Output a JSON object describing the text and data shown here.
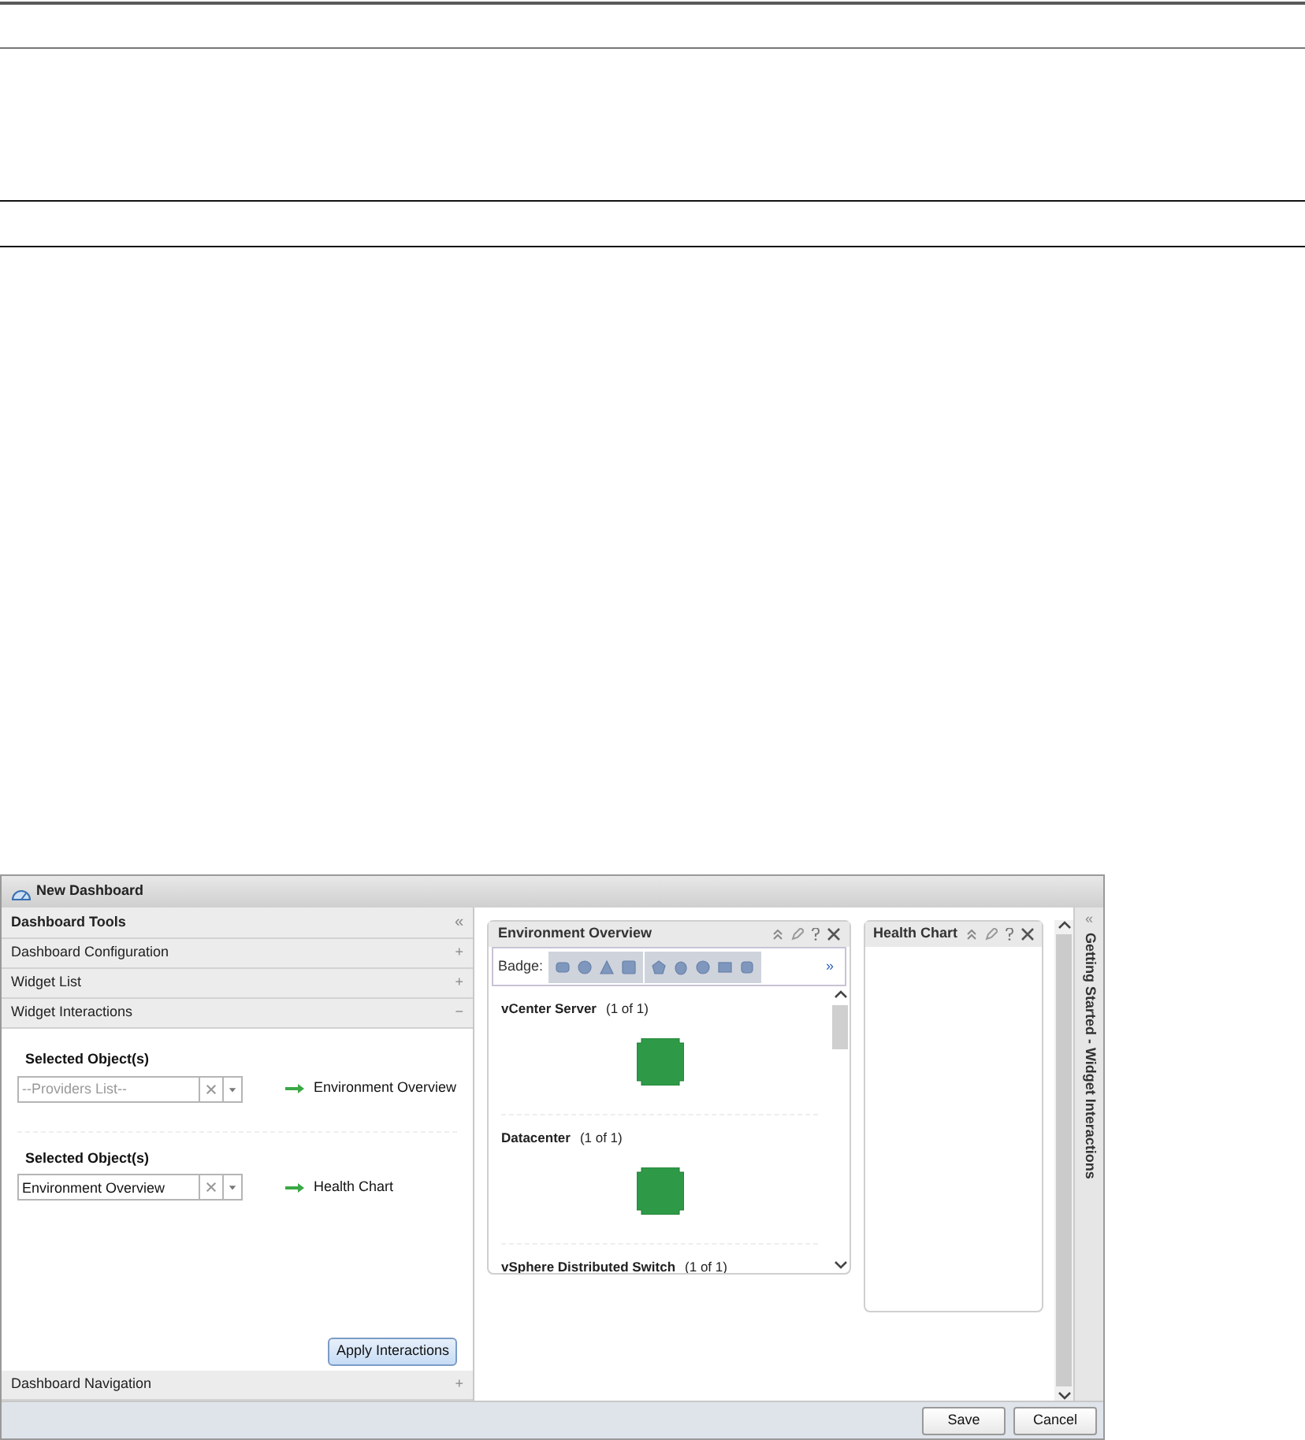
{
  "window": {
    "title": "New Dashboard"
  },
  "tools_panel": {
    "title": "Dashboard Tools",
    "collapse": "«"
  },
  "sections": [
    {
      "label": "Dashboard Configuration",
      "toggle": "+"
    },
    {
      "label": "Widget List",
      "toggle": "+"
    },
    {
      "label": "Widget Interactions",
      "toggle": "−"
    }
  ],
  "interactions": [
    {
      "label": "Selected Object(s)",
      "placeholder": "--Providers List--",
      "target": "Environment Overview"
    },
    {
      "label": "Selected Object(s)",
      "value": "Environment Overview",
      "target": "Health Chart"
    }
  ],
  "apply_button": "Apply Interactions",
  "bottom_sections": [
    {
      "label": "Dashboard Navigation",
      "toggle": "+"
    }
  ],
  "widgets": [
    {
      "kind": "overview",
      "title": "Environment Overview",
      "badge_label": "Badge:",
      "more": "»",
      "groups": [
        {
          "name": "vCenter Server",
          "count": "(1 of 1)"
        },
        {
          "name": "Datacenter",
          "count": "(1 of 1)"
        },
        {
          "name": "vSphere Distributed Switch",
          "count": "(1 of 1)"
        }
      ]
    },
    {
      "kind": "chart",
      "title": "Health Chart"
    }
  ],
  "side_panel": {
    "collapse": "«",
    "title": "Getting Started - Widget Interactions"
  },
  "buttons": [
    "Save",
    "Cancel"
  ]
}
